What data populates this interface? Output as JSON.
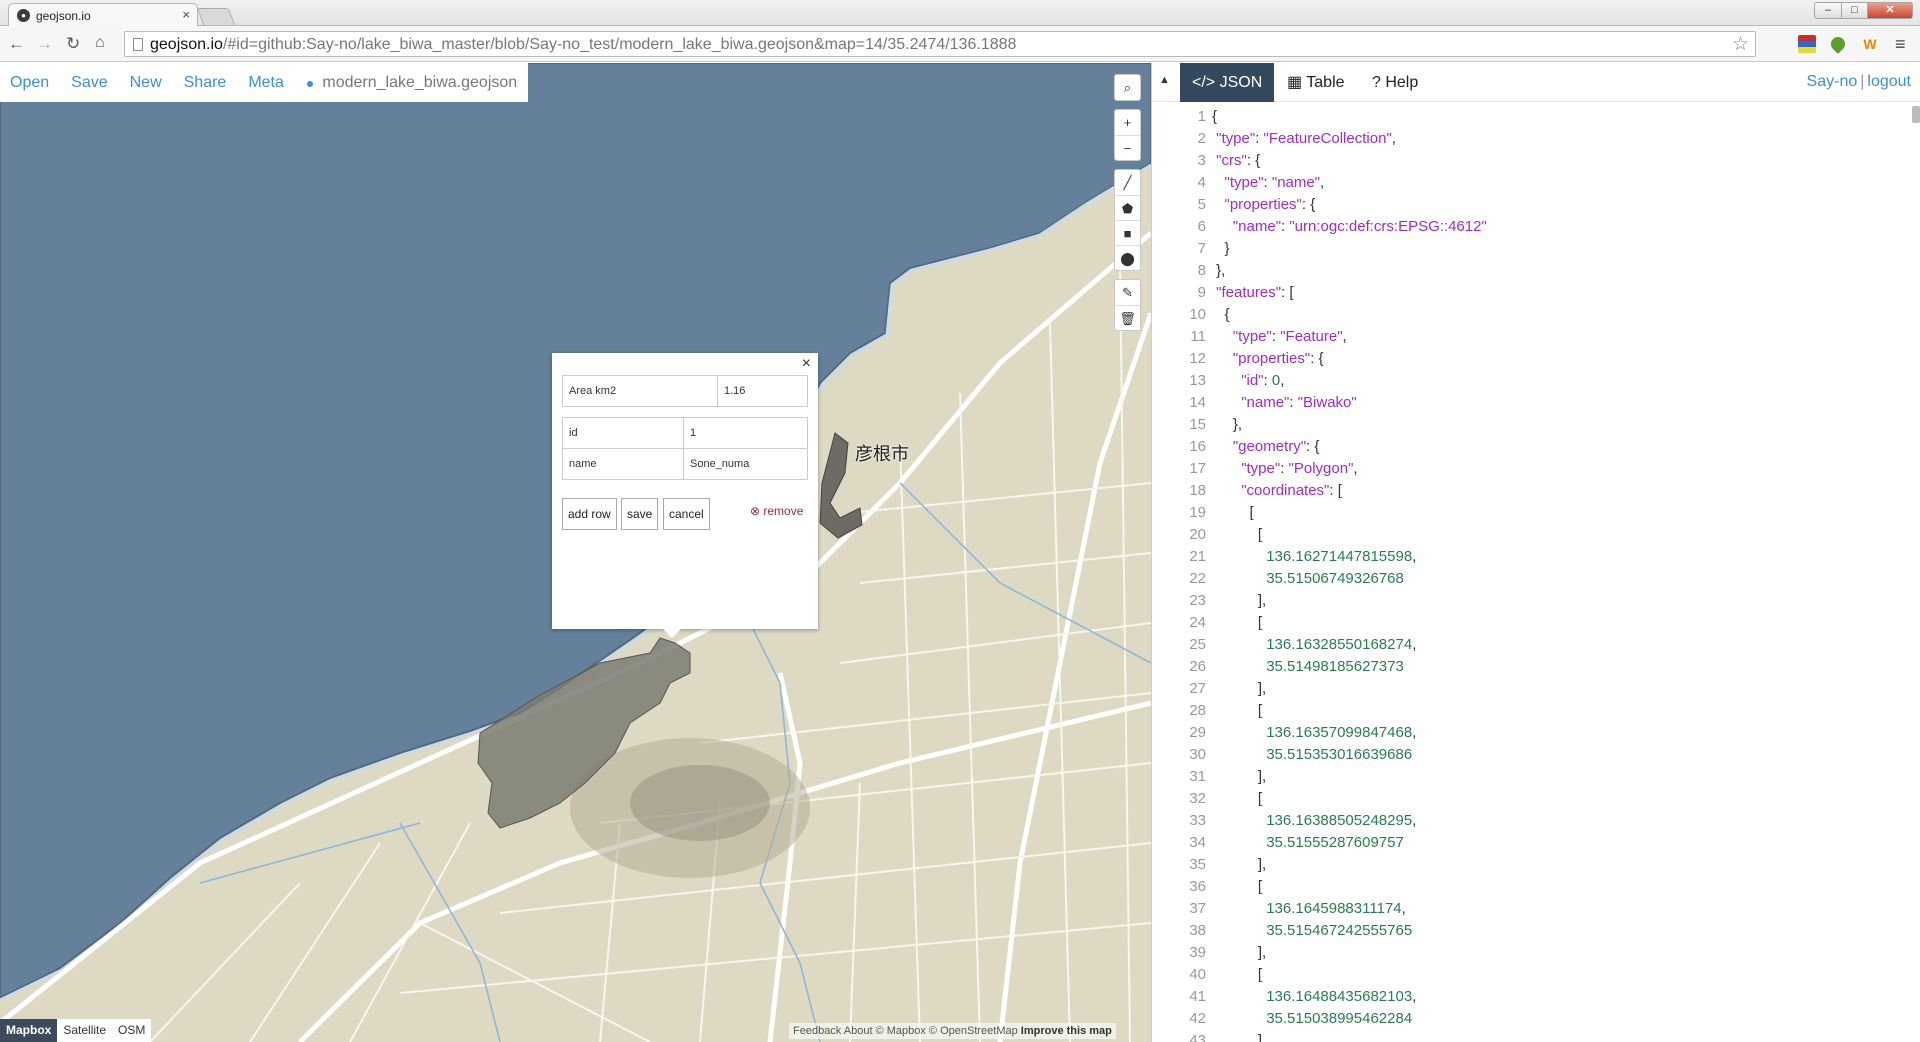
{
  "browser": {
    "tab_title": "geojson.io",
    "tab_close": "×",
    "url_host": "geojson.io",
    "url_rest": "/#id=github:Say-no/lake_biwa_master/blob/Say-no_test/modern_lake_biwa.geojson&map=14/35.2474/136.1888",
    "window_controls": {
      "minimize": "–",
      "maximize": "□",
      "close": "✕"
    },
    "extension_w": "W"
  },
  "topbar": {
    "open": "Open",
    "save": "Save",
    "new": "New",
    "share": "Share",
    "meta": "Meta",
    "filename": "modern_lake_biwa.geojson"
  },
  "map": {
    "city_label": "彦根市",
    "layers": [
      "Mapbox",
      "Satellite",
      "OSM"
    ],
    "active_layer": "Mapbox",
    "attribution": "Feedback  About  © Mapbox © OpenStreetMap",
    "improve": "Improve this map",
    "colors": {
      "water": "#64809a",
      "land": "#ddd9c3",
      "polygon": "#7d7b72"
    }
  },
  "popup": {
    "close": "×",
    "row_area_label": "Area km2",
    "row_area_value": "1.16",
    "row_id_label": "id",
    "row_id_value": "1",
    "row_name_label": "name",
    "row_name_value": "Sone_numa",
    "add_row": "add row",
    "save": "save",
    "cancel": "cancel",
    "remove": "remove"
  },
  "pane": {
    "tabs": {
      "json": "JSON",
      "table": "Table",
      "help": "Help"
    },
    "active_tab": "JSON",
    "user": "Say-no",
    "separator": "|",
    "logout": "logout"
  },
  "editor_lines": [
    [
      {
        "t": "p",
        "v": "{"
      }
    ],
    [
      {
        "t": "p",
        "v": " "
      },
      {
        "t": "k",
        "v": "\"type\""
      },
      {
        "t": "p",
        "v": ": "
      },
      {
        "t": "s",
        "v": "\"FeatureCollection\""
      },
      {
        "t": "p",
        "v": ","
      }
    ],
    [
      {
        "t": "p",
        "v": " "
      },
      {
        "t": "k",
        "v": "\"crs\""
      },
      {
        "t": "p",
        "v": ": {"
      }
    ],
    [
      {
        "t": "p",
        "v": "   "
      },
      {
        "t": "k",
        "v": "\"type\""
      },
      {
        "t": "p",
        "v": ": "
      },
      {
        "t": "s",
        "v": "\"name\""
      },
      {
        "t": "p",
        "v": ","
      }
    ],
    [
      {
        "t": "p",
        "v": "   "
      },
      {
        "t": "k",
        "v": "\"properties\""
      },
      {
        "t": "p",
        "v": ": {"
      }
    ],
    [
      {
        "t": "p",
        "v": "     "
      },
      {
        "t": "k",
        "v": "\"name\""
      },
      {
        "t": "p",
        "v": ": "
      },
      {
        "t": "s",
        "v": "\"urn:ogc:def:crs:EPSG::4612\""
      }
    ],
    [
      {
        "t": "p",
        "v": "   }"
      }
    ],
    [
      {
        "t": "p",
        "v": " },"
      }
    ],
    [
      {
        "t": "p",
        "v": " "
      },
      {
        "t": "k",
        "v": "\"features\""
      },
      {
        "t": "p",
        "v": ": ["
      }
    ],
    [
      {
        "t": "p",
        "v": "   {"
      }
    ],
    [
      {
        "t": "p",
        "v": "     "
      },
      {
        "t": "k",
        "v": "\"type\""
      },
      {
        "t": "p",
        "v": ": "
      },
      {
        "t": "s",
        "v": "\"Feature\""
      },
      {
        "t": "p",
        "v": ","
      }
    ],
    [
      {
        "t": "p",
        "v": "     "
      },
      {
        "t": "k",
        "v": "\"properties\""
      },
      {
        "t": "p",
        "v": ": {"
      }
    ],
    [
      {
        "t": "p",
        "v": "       "
      },
      {
        "t": "k",
        "v": "\"id\""
      },
      {
        "t": "p",
        "v": ": "
      },
      {
        "t": "n",
        "v": "0"
      },
      {
        "t": "p",
        "v": ","
      }
    ],
    [
      {
        "t": "p",
        "v": "       "
      },
      {
        "t": "k",
        "v": "\"name\""
      },
      {
        "t": "p",
        "v": ": "
      },
      {
        "t": "s",
        "v": "\"Biwako\""
      }
    ],
    [
      {
        "t": "p",
        "v": "     },"
      }
    ],
    [
      {
        "t": "p",
        "v": "     "
      },
      {
        "t": "k",
        "v": "\"geometry\""
      },
      {
        "t": "p",
        "v": ": {"
      }
    ],
    [
      {
        "t": "p",
        "v": "       "
      },
      {
        "t": "k",
        "v": "\"type\""
      },
      {
        "t": "p",
        "v": ": "
      },
      {
        "t": "s",
        "v": "\"Polygon\""
      },
      {
        "t": "p",
        "v": ","
      }
    ],
    [
      {
        "t": "p",
        "v": "       "
      },
      {
        "t": "k",
        "v": "\"coordinates\""
      },
      {
        "t": "p",
        "v": ": ["
      }
    ],
    [
      {
        "t": "p",
        "v": "         ["
      }
    ],
    [
      {
        "t": "p",
        "v": "           ["
      }
    ],
    [
      {
        "t": "p",
        "v": "             "
      },
      {
        "t": "n",
        "v": "136.16271447815598"
      },
      {
        "t": "p",
        "v": ","
      }
    ],
    [
      {
        "t": "p",
        "v": "             "
      },
      {
        "t": "n",
        "v": "35.51506749326768"
      }
    ],
    [
      {
        "t": "p",
        "v": "           ],"
      }
    ],
    [
      {
        "t": "p",
        "v": "           ["
      }
    ],
    [
      {
        "t": "p",
        "v": "             "
      },
      {
        "t": "n",
        "v": "136.16328550168274"
      },
      {
        "t": "p",
        "v": ","
      }
    ],
    [
      {
        "t": "p",
        "v": "             "
      },
      {
        "t": "n",
        "v": "35.51498185627373"
      }
    ],
    [
      {
        "t": "p",
        "v": "           ],"
      }
    ],
    [
      {
        "t": "p",
        "v": "           ["
      }
    ],
    [
      {
        "t": "p",
        "v": "             "
      },
      {
        "t": "n",
        "v": "136.16357099847468"
      },
      {
        "t": "p",
        "v": ","
      }
    ],
    [
      {
        "t": "p",
        "v": "             "
      },
      {
        "t": "n",
        "v": "35.515353016639686"
      }
    ],
    [
      {
        "t": "p",
        "v": "           ],"
      }
    ],
    [
      {
        "t": "p",
        "v": "           ["
      }
    ],
    [
      {
        "t": "p",
        "v": "             "
      },
      {
        "t": "n",
        "v": "136.16388505248295"
      },
      {
        "t": "p",
        "v": ","
      }
    ],
    [
      {
        "t": "p",
        "v": "             "
      },
      {
        "t": "n",
        "v": "35.51555287609757"
      }
    ],
    [
      {
        "t": "p",
        "v": "           ],"
      }
    ],
    [
      {
        "t": "p",
        "v": "           ["
      }
    ],
    [
      {
        "t": "p",
        "v": "             "
      },
      {
        "t": "n",
        "v": "136.1645988311174"
      },
      {
        "t": "p",
        "v": ","
      }
    ],
    [
      {
        "t": "p",
        "v": "             "
      },
      {
        "t": "n",
        "v": "35.515467242555765"
      }
    ],
    [
      {
        "t": "p",
        "v": "           ],"
      }
    ],
    [
      {
        "t": "p",
        "v": "           ["
      }
    ],
    [
      {
        "t": "p",
        "v": "             "
      },
      {
        "t": "n",
        "v": "136.16488435682103"
      },
      {
        "t": "p",
        "v": ","
      }
    ],
    [
      {
        "t": "p",
        "v": "             "
      },
      {
        "t": "n",
        "v": "35.515038995462284"
      }
    ],
    [
      {
        "t": "p",
        "v": "           ]"
      }
    ]
  ]
}
